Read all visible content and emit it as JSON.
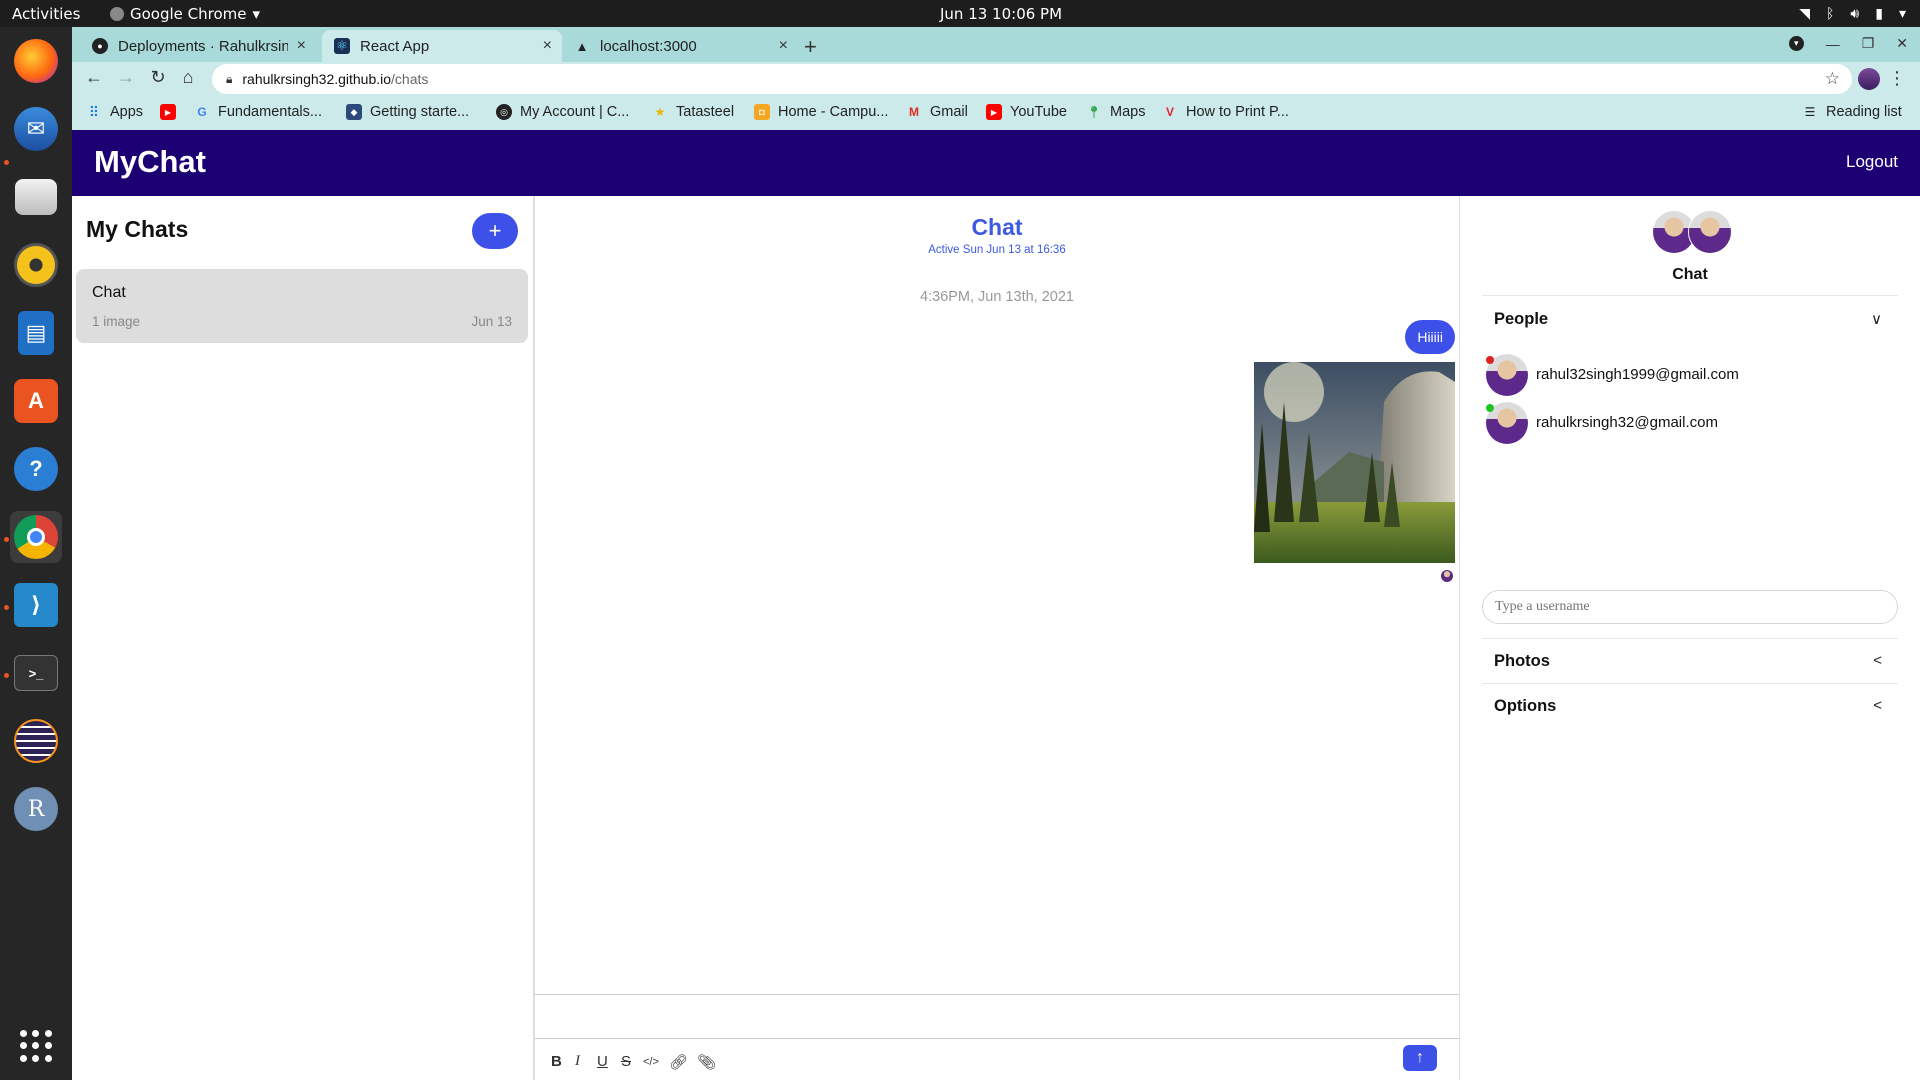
{
  "os": {
    "activities": "Activities",
    "app_menu": "Google Chrome",
    "clock": "Jun 13  10:06 PM"
  },
  "browser": {
    "tabs": [
      {
        "title": "Deployments · Rahulkrsin",
        "icon": "github-icon",
        "active": false
      },
      {
        "title": "React App",
        "icon": "react-icon",
        "active": true
      },
      {
        "title": "localhost:3000",
        "icon": "vercel-icon",
        "active": false
      }
    ],
    "url_host": "rahulkrsingh32.github.io",
    "url_path": "/chats",
    "bookmarks": [
      {
        "label": "Apps",
        "icon": "apps-grid-icon"
      },
      {
        "label": "",
        "icon": "youtube-icon"
      },
      {
        "label": "Fundamentals...",
        "icon": "google-icon"
      },
      {
        "label": "Getting starte...",
        "icon": "bookmark-icon"
      },
      {
        "label": "My Account | C...",
        "icon": "globe-icon"
      },
      {
        "label": "Tatasteel",
        "icon": "star-icon"
      },
      {
        "label": "Home - Campu...",
        "icon": "campus-icon"
      },
      {
        "label": "Gmail",
        "icon": "gmail-icon"
      },
      {
        "label": "YouTube",
        "icon": "youtube-icon"
      },
      {
        "label": "Maps",
        "icon": "maps-icon"
      },
      {
        "label": "How to Print P...",
        "icon": "vivaldi-icon"
      }
    ],
    "reading_list": "Reading list"
  },
  "app": {
    "brand": "MyChat",
    "logout": "Logout",
    "chat_list": {
      "title": "My Chats",
      "new_chat_symbol": "+",
      "chats": [
        {
          "name": "Chat",
          "preview": "1 image",
          "date": "Jun 13"
        }
      ]
    },
    "feed": {
      "title": "Chat",
      "subtitle": "Active Sun Jun 13 at 16:36",
      "timestamp": "4:36PM, Jun 13th, 2021",
      "messages": [
        {
          "type": "text",
          "text": "Hiiiii"
        },
        {
          "type": "image",
          "content": "mountain landscape photo"
        }
      ],
      "toolbar": [
        "B",
        "I",
        "U",
        "S",
        "</>",
        "link",
        "attach"
      ]
    },
    "settings": {
      "chat_name": "Chat",
      "people_title": "People",
      "people": [
        {
          "email": "rahul32singh1999@gmail.com",
          "status_color": "#e02020"
        },
        {
          "email": "rahulkrsingh32@gmail.com",
          "status_color": "#1fc41f"
        }
      ],
      "username_placeholder": "Type a username",
      "photos_title": "Photos",
      "options_title": "Options"
    }
  },
  "colors": {
    "navbar": "#1c0073",
    "accent": "#3d50e8",
    "feed_title": "#3d5ae0"
  }
}
